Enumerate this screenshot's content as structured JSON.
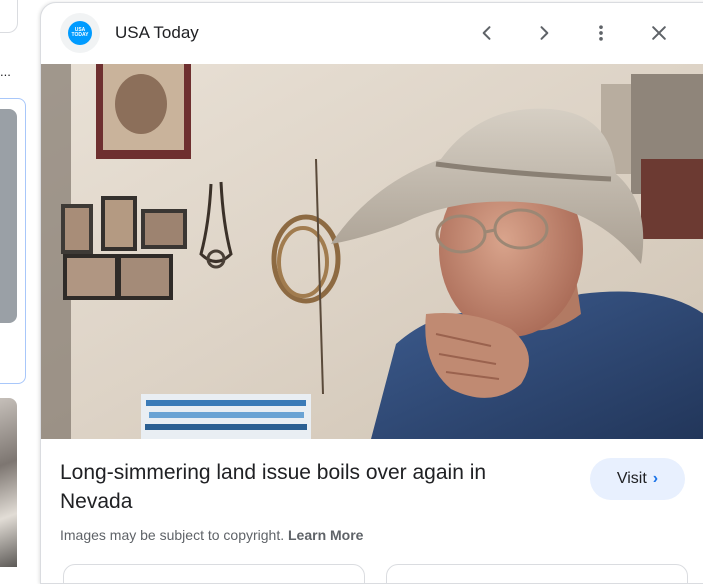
{
  "left_strip": {
    "ellipsis": "..."
  },
  "panel": {
    "source": {
      "name": "USA Today",
      "favicon_text": "USA TODAY",
      "favicon_color": "#009bff"
    },
    "header_icons": [
      "chevron-left-icon",
      "chevron-right-icon",
      "more-vert-icon",
      "close-icon"
    ],
    "image": {
      "icon": "lens-icon"
    },
    "title": "Long-simmering land issue boils over again in Nevada",
    "visit_label": "Visit",
    "copyright_text": "Images may be subject to copyright.",
    "learn_more": "Learn More"
  },
  "colors": {
    "accent": "#1a73e8",
    "visit_bg": "#e8f0fe",
    "border": "#dadce0",
    "text": "#202124",
    "muted": "#5f6368"
  }
}
